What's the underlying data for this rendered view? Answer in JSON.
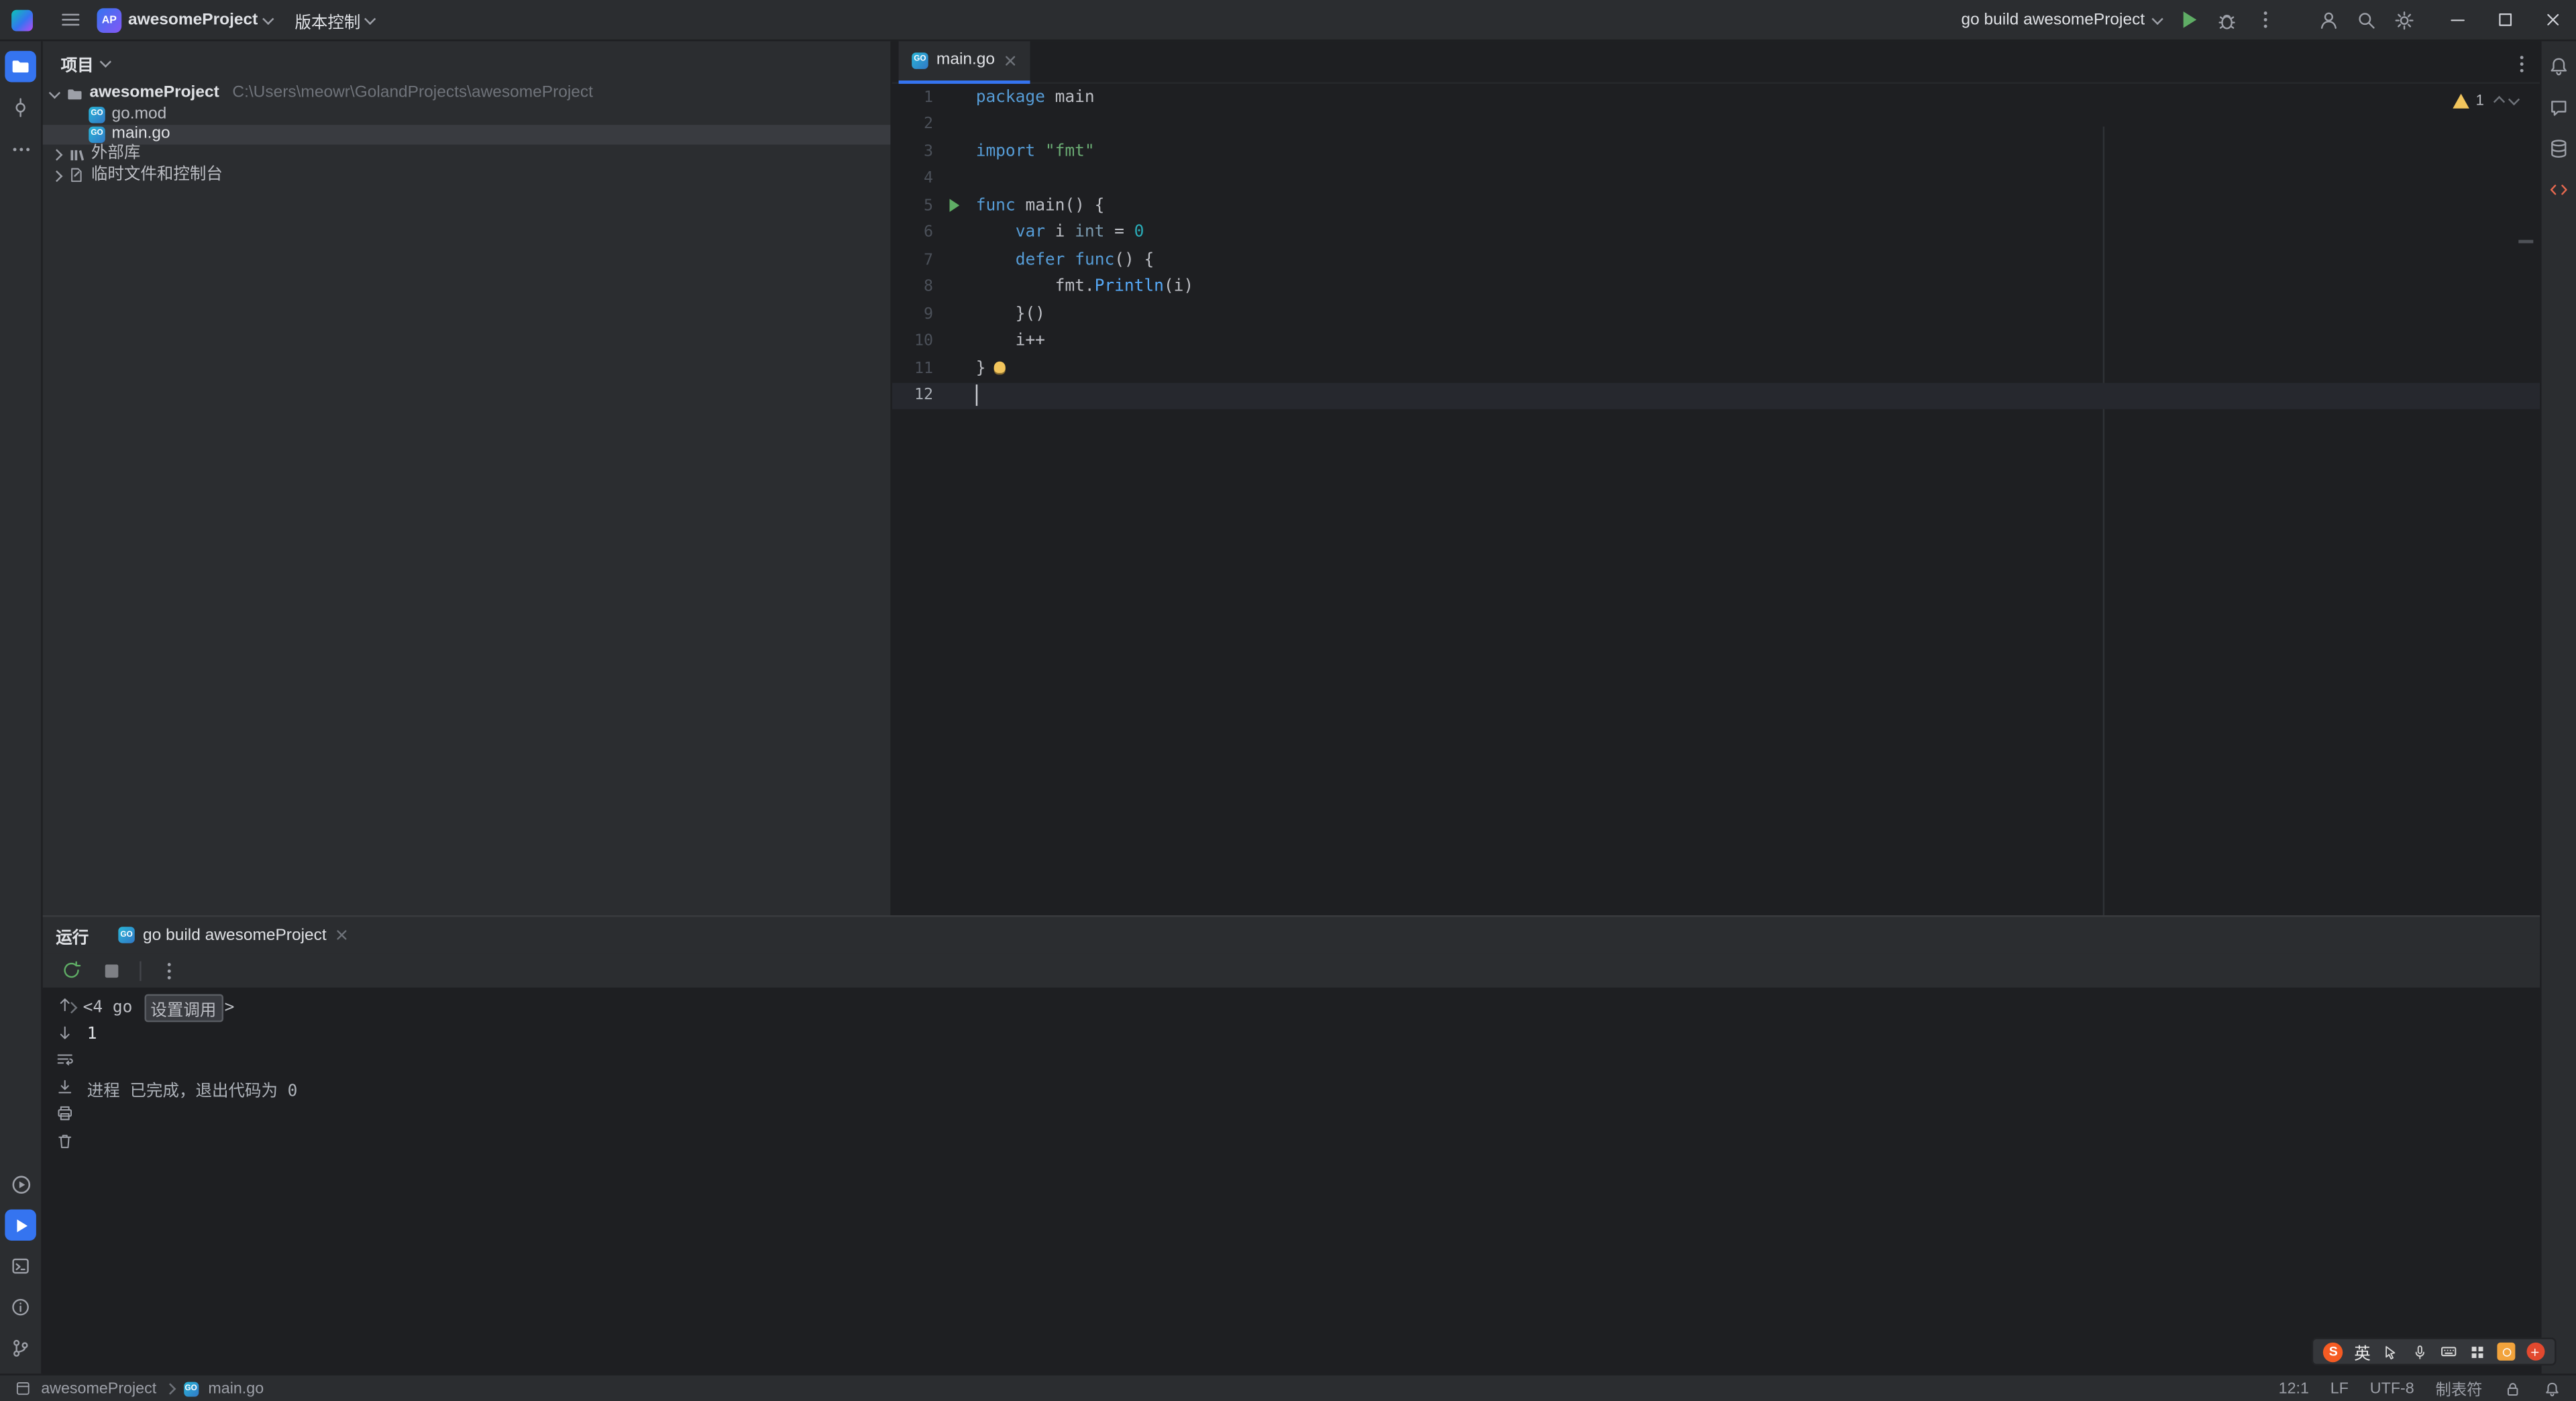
{
  "colors": {
    "accent_blue": "#3574F0",
    "run_green": "#5FAD65",
    "warning_yellow": "#F2C55C",
    "panel_bg": "#2B2D30",
    "editor_bg": "#1E1F22",
    "keyword": "#569CD6",
    "string": "#6AAB73",
    "number": "#2AACB8",
    "function_call": "#56A8F5"
  },
  "title_bar": {
    "project_badge": "AP",
    "project_name": "awesomeProject",
    "vcs_label": "版本控制",
    "run_config": "go build awesomeProject"
  },
  "project_panel": {
    "title": "项目",
    "root_name": "awesomeProject",
    "root_path": "C:\\Users\\meowr\\GolandProjects\\awesomeProject",
    "files": [
      "go.mod",
      "main.go"
    ],
    "external_libraries": "外部库",
    "scratches": "临时文件和控制台"
  },
  "editor": {
    "tab_label": "main.go",
    "warning_count": "1",
    "lines": [
      {
        "n": 1,
        "segments": [
          {
            "t": "package",
            "c": "kw"
          },
          {
            "t": " main",
            "c": "def"
          }
        ]
      },
      {
        "n": 2,
        "segments": []
      },
      {
        "n": 3,
        "segments": [
          {
            "t": "import",
            "c": "kw"
          },
          {
            "t": " ",
            "c": "def"
          },
          {
            "t": "\"fmt\"",
            "c": "str"
          }
        ]
      },
      {
        "n": 4,
        "segments": []
      },
      {
        "n": 5,
        "marker": "run",
        "segments": [
          {
            "t": "func",
            "c": "kw"
          },
          {
            "t": " main() {",
            "c": "def"
          }
        ]
      },
      {
        "n": 6,
        "segments": [
          {
            "t": "    ",
            "c": "def"
          },
          {
            "t": "var",
            "c": "kw"
          },
          {
            "t": " i ",
            "c": "def"
          },
          {
            "t": "int",
            "c": "typ"
          },
          {
            "t": " = ",
            "c": "def"
          },
          {
            "t": "0",
            "c": "num"
          }
        ]
      },
      {
        "n": 7,
        "segments": [
          {
            "t": "    ",
            "c": "def"
          },
          {
            "t": "defer",
            "c": "kw"
          },
          {
            "t": " ",
            "c": "def"
          },
          {
            "t": "func",
            "c": "kw"
          },
          {
            "t": "() {",
            "c": "def"
          }
        ]
      },
      {
        "n": 8,
        "segments": [
          {
            "t": "        ",
            "c": "def"
          },
          {
            "t": "fmt",
            "c": "def"
          },
          {
            "t": ".",
            "c": "def"
          },
          {
            "t": "Println",
            "c": "fn"
          },
          {
            "t": "(i)",
            "c": "def"
          }
        ]
      },
      {
        "n": 9,
        "segments": [
          {
            "t": "    }()",
            "c": "def"
          }
        ]
      },
      {
        "n": 10,
        "segments": [
          {
            "t": "    i++",
            "c": "def"
          }
        ]
      },
      {
        "n": 11,
        "bulb": true,
        "segments": [
          {
            "t": "}",
            "c": "def"
          }
        ]
      },
      {
        "n": 12,
        "caret": true,
        "segments": []
      }
    ]
  },
  "run_panel": {
    "title": "运行",
    "tab_label": "go build awesomeProject",
    "console": {
      "fold_prefix": "<4 go ",
      "fold_chip": "设置调用",
      "fold_suffix": ">",
      "output": "1",
      "exit_line": "进程 已完成，退出代码为 0"
    }
  },
  "status_bar": {
    "project": "awesomeProject",
    "file": "main.go",
    "caret_position": "12:1",
    "line_separator": "LF",
    "encoding": "UTF-8",
    "indent": "制表符"
  },
  "ime_bar": {
    "logo_letter": "S",
    "lang_mode": "英"
  }
}
